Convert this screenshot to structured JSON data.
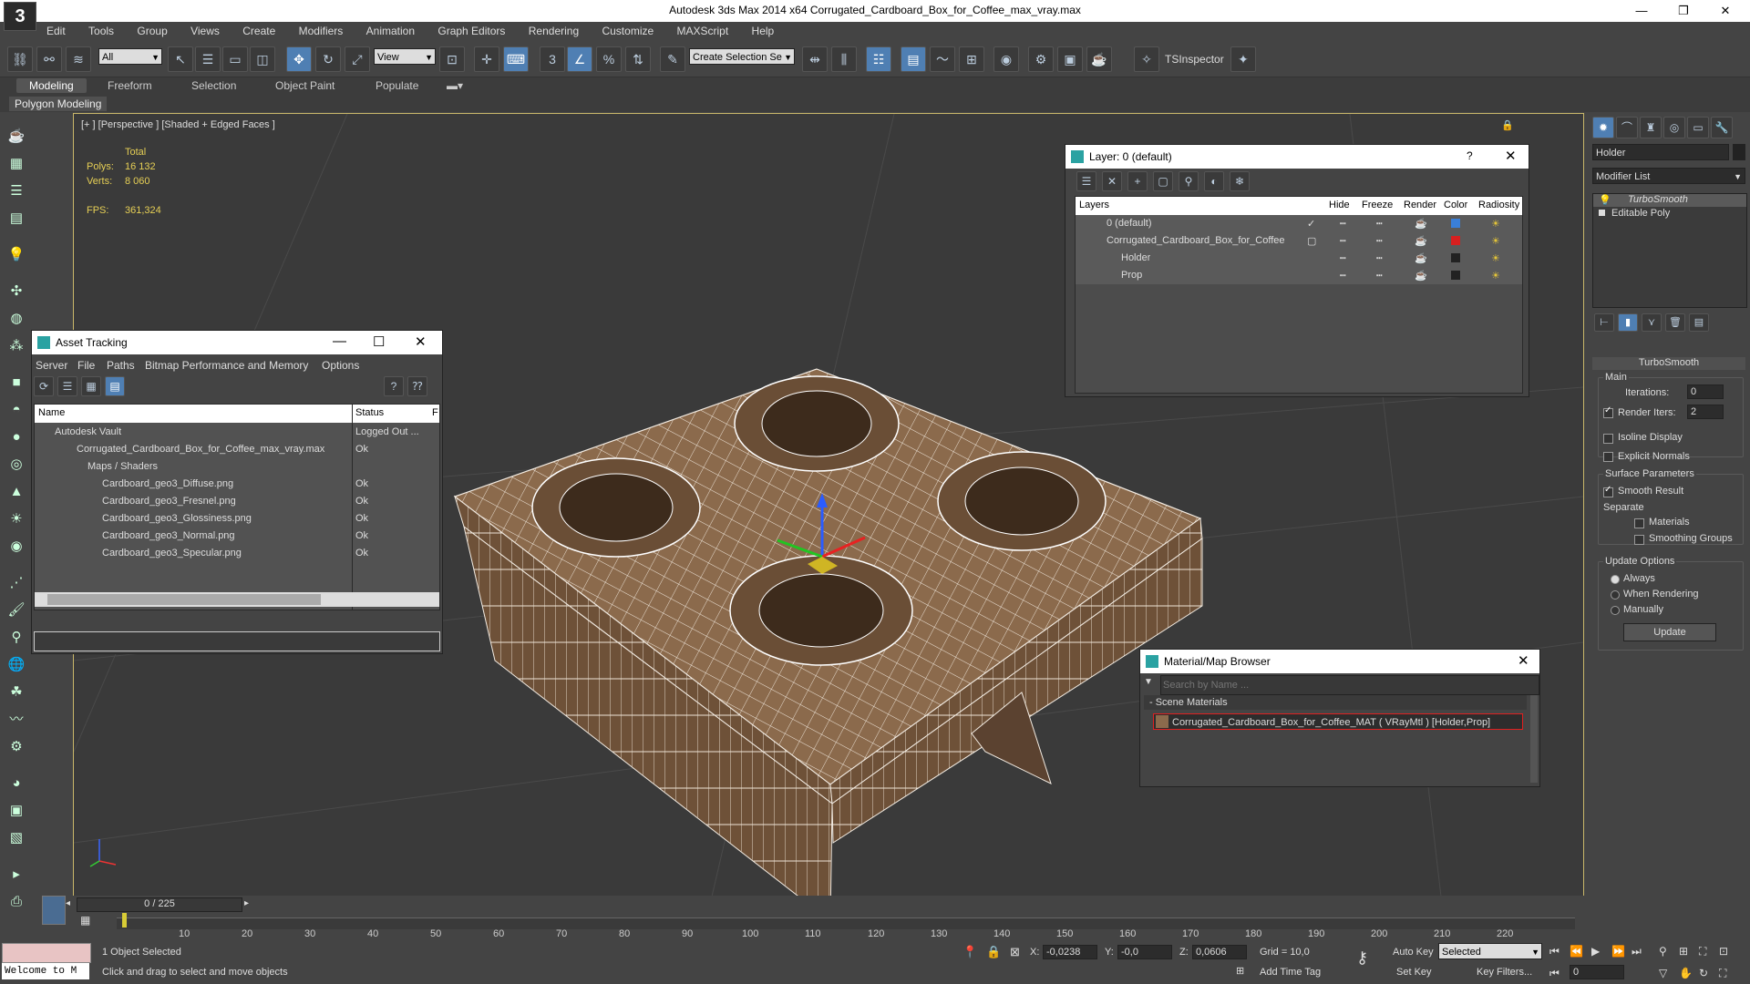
{
  "window": {
    "title": "Autodesk 3ds Max  2014 x64      Corrugated_Cardboard_Box_for_Coffee_max_vray.max",
    "logo": "3"
  },
  "menu": [
    "Edit",
    "Tools",
    "Group",
    "Views",
    "Create",
    "Modifiers",
    "Animation",
    "Graph Editors",
    "Rendering",
    "Customize",
    "MAXScript",
    "Help"
  ],
  "toolbar": {
    "selection_filter": "All",
    "ref_coord": "View",
    "selection_set": "Create Selection Se",
    "tsinspector": "TSInspector"
  },
  "ribbon": {
    "tabs": [
      "Modeling",
      "Freeform",
      "Selection",
      "Object Paint",
      "Populate"
    ],
    "active_tab": "Modeling",
    "sub": "Polygon Modeling"
  },
  "viewport": {
    "label": "[+ ] [Perspective ] [Shaded + Edged Faces ]",
    "stats": {
      "total_label": "Total",
      "polys_label": "Polys:",
      "polys": "16 132",
      "verts_label": "Verts:",
      "verts": "8 060",
      "fps_label": "FPS:",
      "fps": "361,324"
    }
  },
  "asset_tracking": {
    "title": "Asset Tracking",
    "menu": [
      "Server",
      "File",
      "Paths",
      "Bitmap Performance and Memory",
      "Options"
    ],
    "columns": [
      "Name",
      "Status",
      "F"
    ],
    "rows": [
      {
        "name": "Autodesk Vault",
        "status": "Logged Out ...",
        "indent": 1
      },
      {
        "name": "Corrugated_Cardboard_Box_for_Coffee_max_vray.max",
        "status": "Ok",
        "indent": 2
      },
      {
        "name": "Maps / Shaders",
        "status": "",
        "indent": 3
      },
      {
        "name": "Cardboard_geo3_Diffuse.png",
        "status": "Ok",
        "indent": 4
      },
      {
        "name": "Cardboard_geo3_Fresnel.png",
        "status": "Ok",
        "indent": 4
      },
      {
        "name": "Cardboard_geo3_Glossiness.png",
        "status": "Ok",
        "indent": 4
      },
      {
        "name": "Cardboard_geo3_Normal.png",
        "status": "Ok",
        "indent": 4
      },
      {
        "name": "Cardboard_geo3_Specular.png",
        "status": "Ok",
        "indent": 4
      }
    ]
  },
  "layer_manager": {
    "title": "Layer: 0 (default)",
    "help": "?",
    "columns": [
      "Layers",
      "Hide",
      "Freeze",
      "Render",
      "Color",
      "Radiosity"
    ],
    "rows": [
      {
        "name": "0 (default)",
        "color": "#3a7fd8",
        "indent": 1
      },
      {
        "name": "Corrugated_Cardboard_Box_for_Coffee",
        "color": "#d82020",
        "indent": 1
      },
      {
        "name": "Holder",
        "color": "#222222",
        "indent": 2
      },
      {
        "name": "Prop",
        "color": "#222222",
        "indent": 2
      }
    ]
  },
  "material_browser": {
    "title": "Material/Map Browser",
    "search_placeholder": "Search by Name ...",
    "group": "- Scene Materials",
    "item": "Corrugated_Cardboard_Box_for_Coffee_MAT ( VRayMtl ) [Holder,Prop]"
  },
  "command_panel": {
    "object_name": "Holder",
    "modifier_list": "Modifier List",
    "stack": [
      "TurboSmooth",
      "Editable Poly"
    ],
    "rollout_title": "TurboSmooth",
    "main_label": "Main",
    "iterations_label": "Iterations:",
    "iterations": "0",
    "render_iters_label": "Render Iters:",
    "render_iters": "2",
    "isoline": "Isoline Display",
    "explicit_normals": "Explicit Normals",
    "surface_params": "Surface Parameters",
    "smooth_result": "Smooth Result",
    "separate": "Separate",
    "materials": "Materials",
    "smoothing_groups": "Smoothing Groups",
    "update_options": "Update Options",
    "always": "Always",
    "when_rendering": "When Rendering",
    "manually": "Manually",
    "update_button": "Update"
  },
  "timeline": {
    "frame": "0 / 225",
    "ticks": [
      "10",
      "20",
      "30",
      "40",
      "50",
      "60",
      "70",
      "80",
      "90",
      "100",
      "110",
      "120",
      "130",
      "140",
      "150",
      "160",
      "170",
      "180",
      "190",
      "200",
      "210",
      "220"
    ]
  },
  "status": {
    "script_box": "Welcome to M",
    "selected": "1 Object Selected",
    "prompt": "Click and drag to select and move objects",
    "x_label": "X:",
    "x": "-0,0238",
    "y_label": "Y:",
    "y": "-0,0",
    "z_label": "Z:",
    "z": "0,0606",
    "grid": "Grid = 10,0",
    "auto_key": "Auto Key",
    "key_mode": "Selected",
    "set_key": "Set Key",
    "key_filters": "Key Filters...",
    "add_time_tag": "Add Time Tag",
    "frame_field": "0"
  }
}
